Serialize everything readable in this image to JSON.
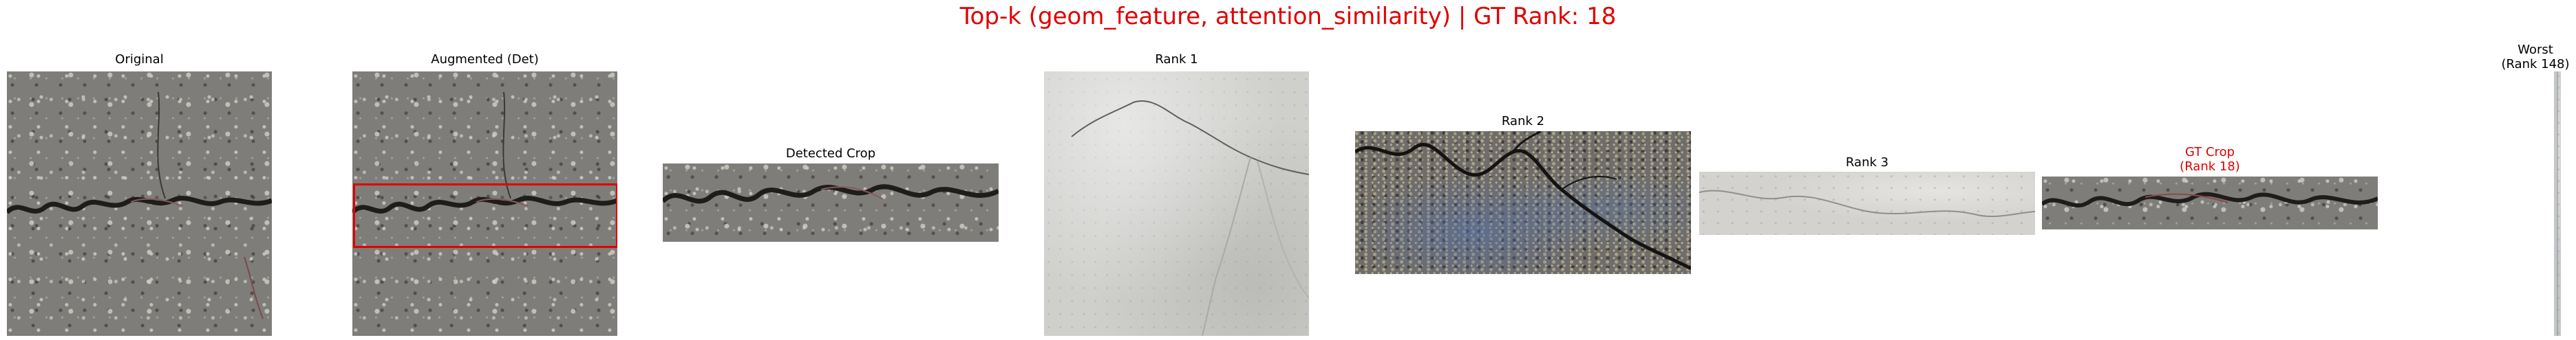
{
  "figure": {
    "suptitle": "Top-k (geom_feature, attention_similarity) | GT Rank: 18",
    "title_color": "#e00000",
    "detection_box_color": "#e00000"
  },
  "panels": {
    "original": {
      "title": "Original"
    },
    "augmented": {
      "title": "Augmented (Det)"
    },
    "detected_crop": {
      "title": "Detected Crop"
    },
    "rank1": {
      "title": "Rank 1"
    },
    "rank2": {
      "title": "Rank 2"
    },
    "rank3": {
      "title": "Rank 3"
    },
    "gt_crop": {
      "title": "GT Crop\n(Rank 18)"
    },
    "worst": {
      "title": "Worst\n(Rank 148)"
    }
  }
}
